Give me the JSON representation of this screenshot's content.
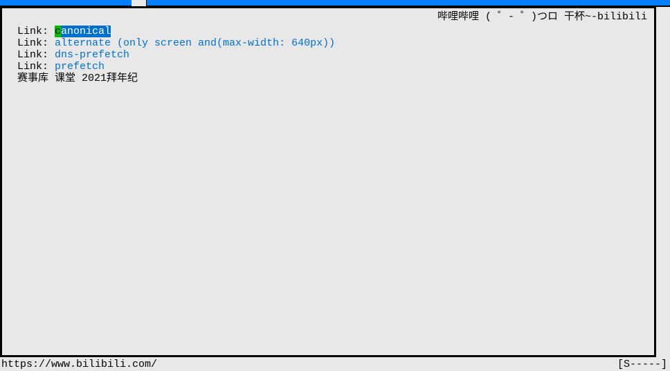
{
  "titlebar": {
    "text": ""
  },
  "page": {
    "title_right": "哔哩哔哩 ( ゜- ゜)つロ 干杯~-bilibili",
    "links": [
      {
        "label": "Link: ",
        "cursor_char": "c",
        "value_rest": "anonical",
        "selected": true
      },
      {
        "label": "Link: ",
        "value": "alternate (only screen and(max-width: 640px))",
        "selected": false
      },
      {
        "label": "Link: ",
        "value": "dns-prefetch",
        "selected": false
      },
      {
        "label": "Link: ",
        "value": "prefetch",
        "selected": false
      }
    ],
    "body_text": "赛事库 课堂 2021拜年纪"
  },
  "status": {
    "left": "https://www.bilibili.com/",
    "right": "[S-----]"
  }
}
